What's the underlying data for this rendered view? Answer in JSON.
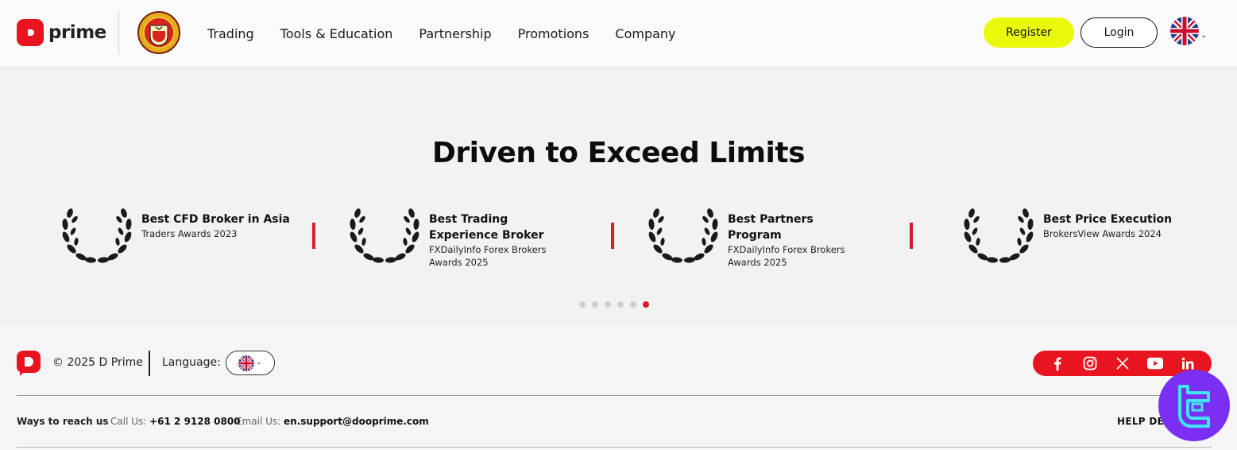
{
  "header": {
    "brand": "prime",
    "nav": [
      "Trading",
      "Tools & Education",
      "Partnership",
      "Promotions",
      "Company"
    ],
    "register_label": "Register",
    "login_label": "Login",
    "language_icon": "uk-flag-icon"
  },
  "hero": {
    "title": "Driven to Exceed Limits",
    "awards": [
      {
        "title": "Best CFD Broker in Asia",
        "sub": "Traders Awards 2023"
      },
      {
        "title": "Best Trading Experience Broker",
        "sub": "FXDailyInfo Forex Brokers Awards 2025"
      },
      {
        "title": "Best Partners Program",
        "sub": "FXDailyInfo Forex Brokers Awards 2025"
      },
      {
        "title": "Best Price Execution",
        "sub": "BrokersView Awards 2024"
      }
    ],
    "carousel": {
      "pages": 6,
      "active_page": 6
    }
  },
  "footer": {
    "copyright": "© 2025 D Prime",
    "language_label": "Language:",
    "social": [
      "facebook-icon",
      "instagram-icon",
      "x-icon",
      "youtube-icon",
      "linkedin-icon"
    ],
    "reach_label": "Ways to reach us",
    "call_label": "Call Us:",
    "call_value": "+61 2 9128 0800",
    "email_label": "Email Us:",
    "email_value": "en.support@dooprime.com",
    "help_label": "HELP DES"
  },
  "colors": {
    "brand_red": "#e8141f",
    "accent_yellow": "#eaf90c",
    "separator_red": "#d81a2c",
    "watermark_purple": "#7b2ff2"
  }
}
